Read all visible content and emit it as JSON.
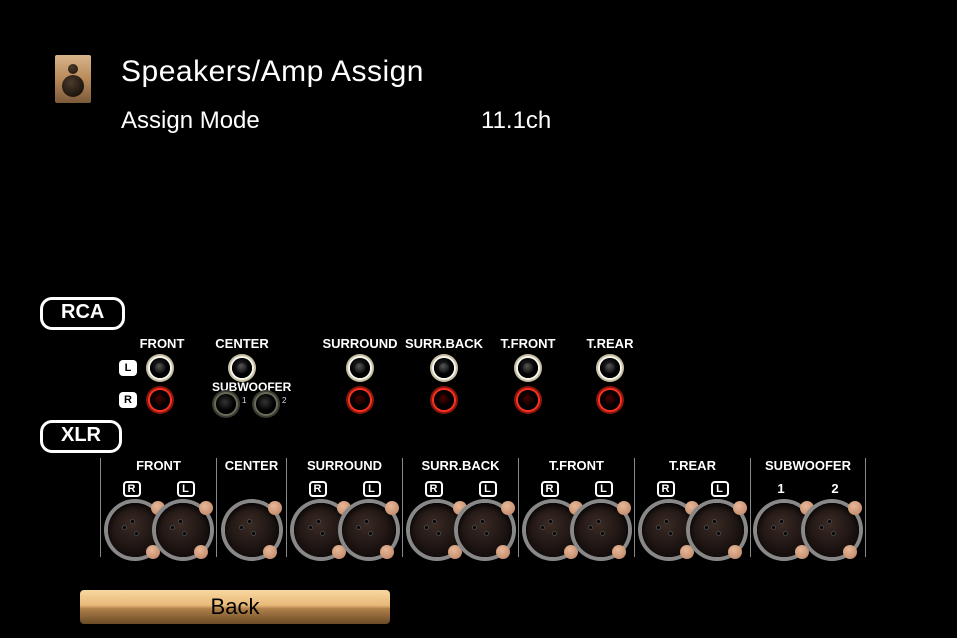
{
  "page": {
    "title": "Speakers/Amp Assign",
    "mode_label": "Assign Mode",
    "mode_value": "11.1ch"
  },
  "section_labels": {
    "rca": "RCA",
    "xlr": "XLR"
  },
  "lr": {
    "L": "L",
    "R": "R"
  },
  "rca": {
    "front": "FRONT",
    "center": "CENTER",
    "subwoofer": "SUBWOOFER",
    "sub1": "1",
    "sub2": "2",
    "surround": "SURROUND",
    "surrback": "SURR.BACK",
    "tfront": "T.FRONT",
    "trear": "T.REAR"
  },
  "xlr": {
    "groups": [
      {
        "label": "FRONT",
        "sub": [
          "R",
          "L"
        ]
      },
      {
        "label": "CENTER",
        "sub": []
      },
      {
        "label": "SURROUND",
        "sub": [
          "R",
          "L"
        ]
      },
      {
        "label": "SURR.BACK",
        "sub": [
          "R",
          "L"
        ]
      },
      {
        "label": "T.FRONT",
        "sub": [
          "R",
          "L"
        ]
      },
      {
        "label": "T.REAR",
        "sub": [
          "R",
          "L"
        ]
      },
      {
        "label": "SUBWOOFER",
        "sub": [
          "1",
          "2"
        ]
      }
    ]
  },
  "buttons": {
    "back": "Back"
  }
}
